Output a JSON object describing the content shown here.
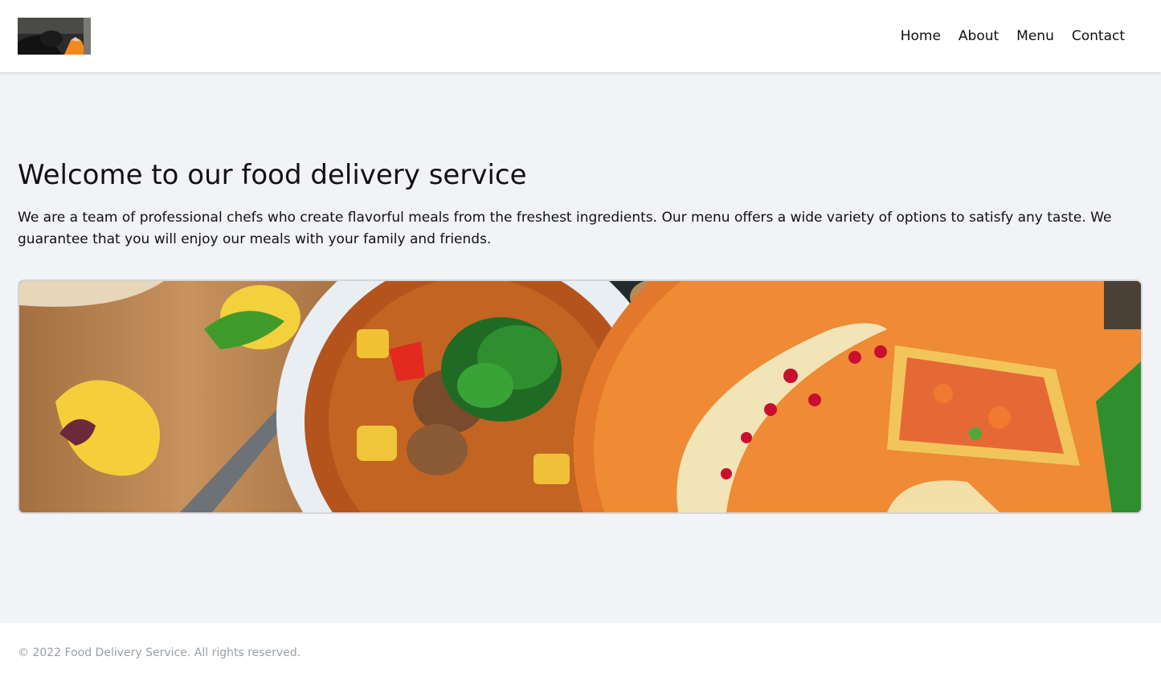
{
  "header": {
    "logo_alt": "logo",
    "nav": [
      {
        "label": "Home"
      },
      {
        "label": "About"
      },
      {
        "label": "Menu"
      },
      {
        "label": "Contact"
      }
    ]
  },
  "main": {
    "title": "Welcome to our food delivery service",
    "intro": "We are a team of professional chefs who create flavorful meals from the freshest ingredients. Our menu offers a wide variety of options to satisfy any taste. We guarantee that you will enjoy our meals with your family and friends.",
    "hero_alt": "food photo"
  },
  "footer": {
    "copyright": "© 2022 Food Delivery Service. All rights reserved."
  },
  "colors": {
    "background": "#f2f3f6",
    "surface": "#ffffff",
    "text": "#111111",
    "muted": "#9aa0a6"
  }
}
